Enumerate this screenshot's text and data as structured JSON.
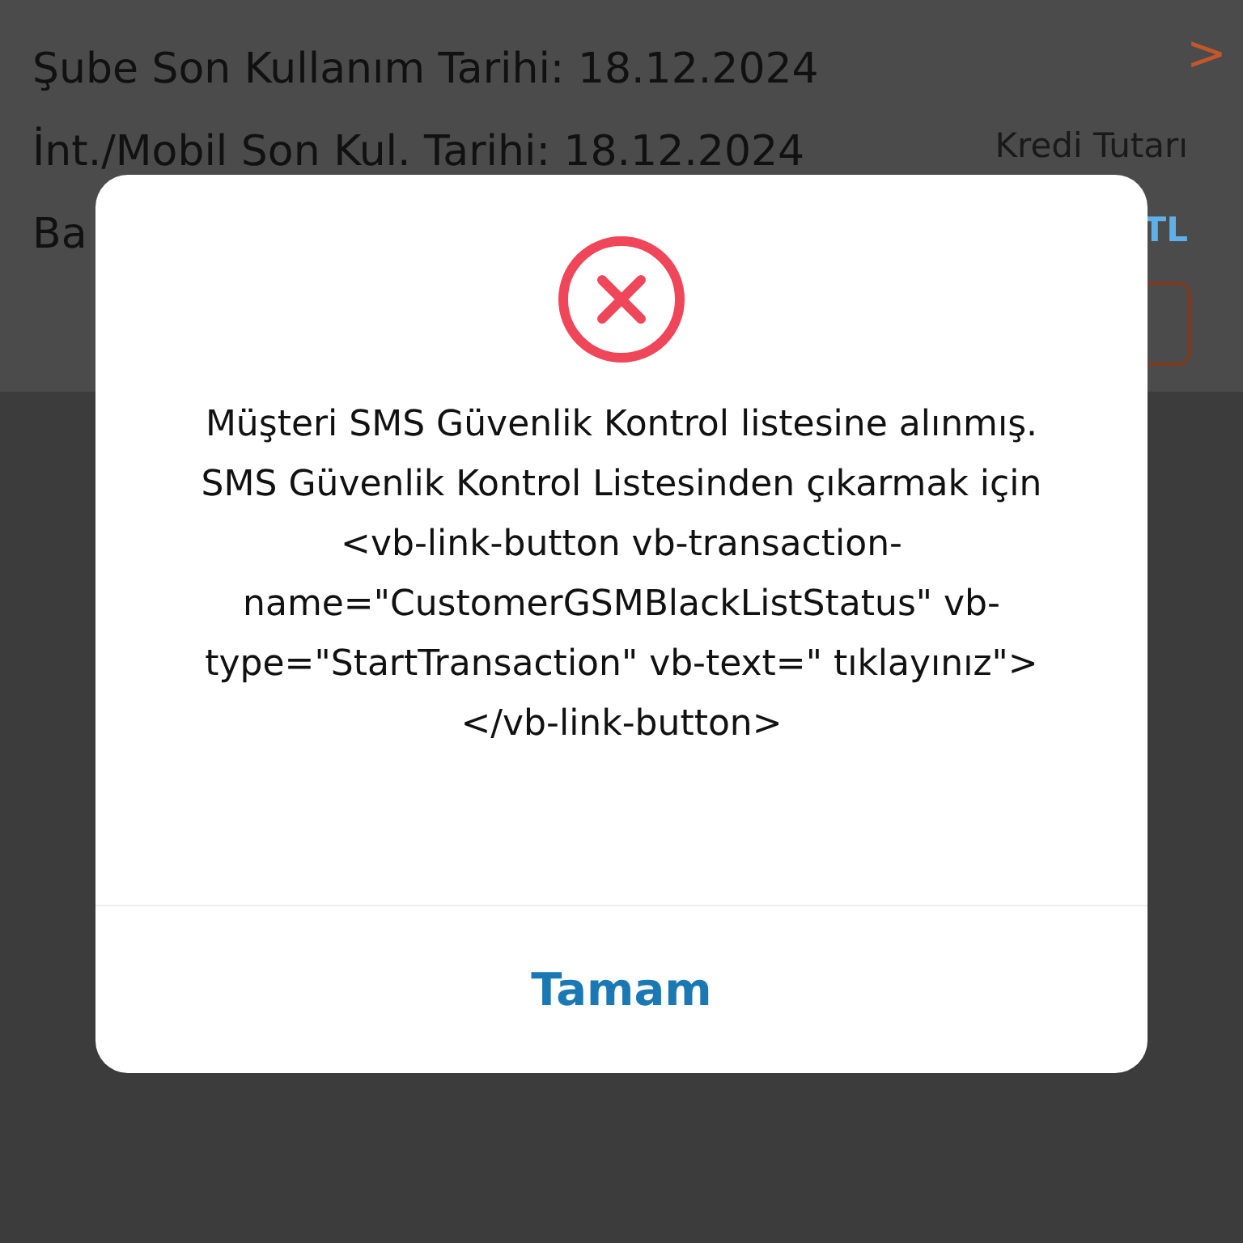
{
  "background": {
    "details": [
      "Şube Son Kullanım Tarihi: 18.12.2024",
      "İnt./Mobil Son Kul. Tarihi: 18.12.2024",
      "Ba"
    ],
    "side_label": "Kredi Tutarı",
    "currency": "TL",
    "chevron": ">"
  },
  "dialog": {
    "kind": "error",
    "message": "Müşteri SMS Güvenlik Kontrol listesine alınmış. SMS Güvenlik Kontrol Listesinden çıkarmak için <vb-link-button vb-transaction-name=\"CustomerGSMBlackListStatus\" vb-type=\"StartTransaction\" vb-text=\" tıklayınız\"></vb-link-button>",
    "buttons": [
      "Tamam"
    ]
  }
}
